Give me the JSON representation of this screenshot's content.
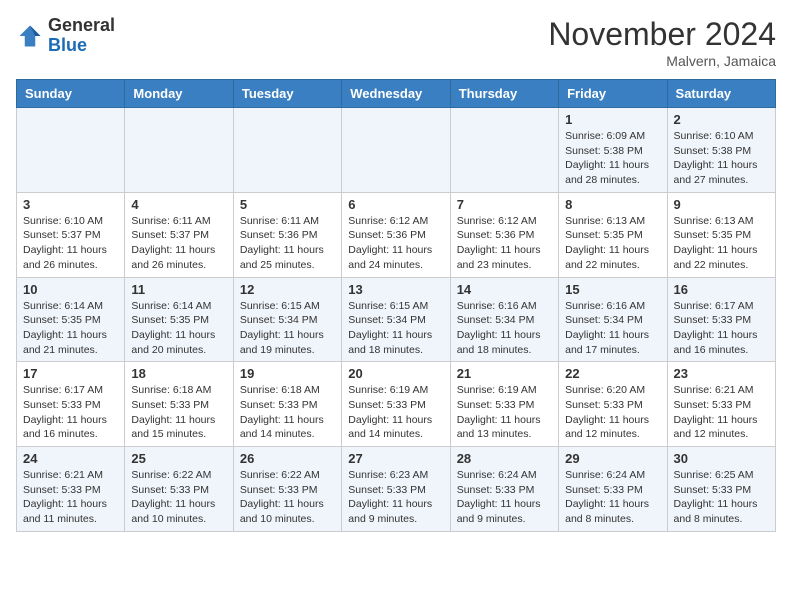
{
  "header": {
    "logo": {
      "general": "General",
      "blue": "Blue",
      "tagline": "GeneralBlue"
    },
    "title": "November 2024",
    "location": "Malvern, Jamaica"
  },
  "weekdays": [
    "Sunday",
    "Monday",
    "Tuesday",
    "Wednesday",
    "Thursday",
    "Friday",
    "Saturday"
  ],
  "weeks": [
    [
      {
        "day": "",
        "info": ""
      },
      {
        "day": "",
        "info": ""
      },
      {
        "day": "",
        "info": ""
      },
      {
        "day": "",
        "info": ""
      },
      {
        "day": "",
        "info": ""
      },
      {
        "day": "1",
        "info": "Sunrise: 6:09 AM\nSunset: 5:38 PM\nDaylight: 11 hours\nand 28 minutes."
      },
      {
        "day": "2",
        "info": "Sunrise: 6:10 AM\nSunset: 5:38 PM\nDaylight: 11 hours\nand 27 minutes."
      }
    ],
    [
      {
        "day": "3",
        "info": "Sunrise: 6:10 AM\nSunset: 5:37 PM\nDaylight: 11 hours\nand 26 minutes."
      },
      {
        "day": "4",
        "info": "Sunrise: 6:11 AM\nSunset: 5:37 PM\nDaylight: 11 hours\nand 26 minutes."
      },
      {
        "day": "5",
        "info": "Sunrise: 6:11 AM\nSunset: 5:36 PM\nDaylight: 11 hours\nand 25 minutes."
      },
      {
        "day": "6",
        "info": "Sunrise: 6:12 AM\nSunset: 5:36 PM\nDaylight: 11 hours\nand 24 minutes."
      },
      {
        "day": "7",
        "info": "Sunrise: 6:12 AM\nSunset: 5:36 PM\nDaylight: 11 hours\nand 23 minutes."
      },
      {
        "day": "8",
        "info": "Sunrise: 6:13 AM\nSunset: 5:35 PM\nDaylight: 11 hours\nand 22 minutes."
      },
      {
        "day": "9",
        "info": "Sunrise: 6:13 AM\nSunset: 5:35 PM\nDaylight: 11 hours\nand 22 minutes."
      }
    ],
    [
      {
        "day": "10",
        "info": "Sunrise: 6:14 AM\nSunset: 5:35 PM\nDaylight: 11 hours\nand 21 minutes."
      },
      {
        "day": "11",
        "info": "Sunrise: 6:14 AM\nSunset: 5:35 PM\nDaylight: 11 hours\nand 20 minutes."
      },
      {
        "day": "12",
        "info": "Sunrise: 6:15 AM\nSunset: 5:34 PM\nDaylight: 11 hours\nand 19 minutes."
      },
      {
        "day": "13",
        "info": "Sunrise: 6:15 AM\nSunset: 5:34 PM\nDaylight: 11 hours\nand 18 minutes."
      },
      {
        "day": "14",
        "info": "Sunrise: 6:16 AM\nSunset: 5:34 PM\nDaylight: 11 hours\nand 18 minutes."
      },
      {
        "day": "15",
        "info": "Sunrise: 6:16 AM\nSunset: 5:34 PM\nDaylight: 11 hours\nand 17 minutes."
      },
      {
        "day": "16",
        "info": "Sunrise: 6:17 AM\nSunset: 5:33 PM\nDaylight: 11 hours\nand 16 minutes."
      }
    ],
    [
      {
        "day": "17",
        "info": "Sunrise: 6:17 AM\nSunset: 5:33 PM\nDaylight: 11 hours\nand 16 minutes."
      },
      {
        "day": "18",
        "info": "Sunrise: 6:18 AM\nSunset: 5:33 PM\nDaylight: 11 hours\nand 15 minutes."
      },
      {
        "day": "19",
        "info": "Sunrise: 6:18 AM\nSunset: 5:33 PM\nDaylight: 11 hours\nand 14 minutes."
      },
      {
        "day": "20",
        "info": "Sunrise: 6:19 AM\nSunset: 5:33 PM\nDaylight: 11 hours\nand 14 minutes."
      },
      {
        "day": "21",
        "info": "Sunrise: 6:19 AM\nSunset: 5:33 PM\nDaylight: 11 hours\nand 13 minutes."
      },
      {
        "day": "22",
        "info": "Sunrise: 6:20 AM\nSunset: 5:33 PM\nDaylight: 11 hours\nand 12 minutes."
      },
      {
        "day": "23",
        "info": "Sunrise: 6:21 AM\nSunset: 5:33 PM\nDaylight: 11 hours\nand 12 minutes."
      }
    ],
    [
      {
        "day": "24",
        "info": "Sunrise: 6:21 AM\nSunset: 5:33 PM\nDaylight: 11 hours\nand 11 minutes."
      },
      {
        "day": "25",
        "info": "Sunrise: 6:22 AM\nSunset: 5:33 PM\nDaylight: 11 hours\nand 10 minutes."
      },
      {
        "day": "26",
        "info": "Sunrise: 6:22 AM\nSunset: 5:33 PM\nDaylight: 11 hours\nand 10 minutes."
      },
      {
        "day": "27",
        "info": "Sunrise: 6:23 AM\nSunset: 5:33 PM\nDaylight: 11 hours\nand 9 minutes."
      },
      {
        "day": "28",
        "info": "Sunrise: 6:24 AM\nSunset: 5:33 PM\nDaylight: 11 hours\nand 9 minutes."
      },
      {
        "day": "29",
        "info": "Sunrise: 6:24 AM\nSunset: 5:33 PM\nDaylight: 11 hours\nand 8 minutes."
      },
      {
        "day": "30",
        "info": "Sunrise: 6:25 AM\nSunset: 5:33 PM\nDaylight: 11 hours\nand 8 minutes."
      }
    ]
  ]
}
